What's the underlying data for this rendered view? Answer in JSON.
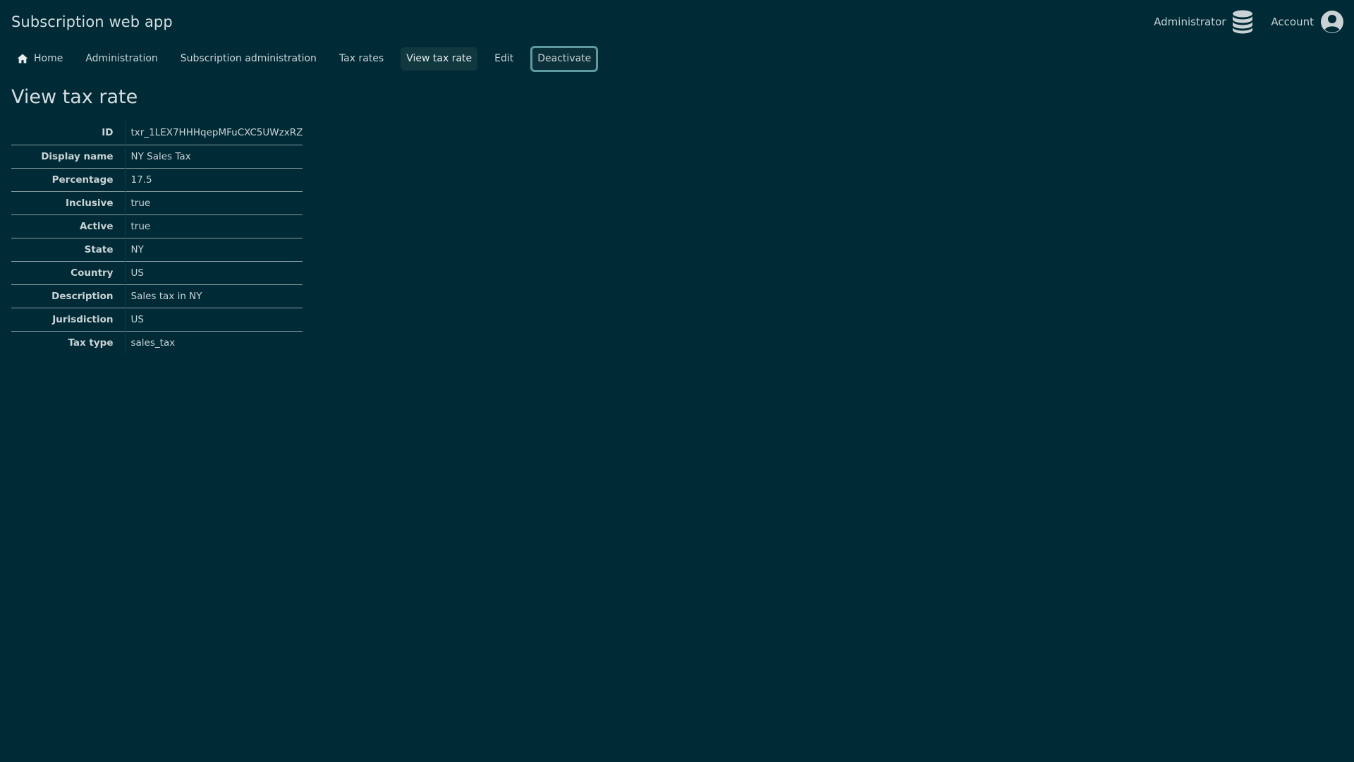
{
  "header": {
    "app_title": "Subscription web app",
    "administrator_label": "Administrator",
    "administrator_icon": "database-icon",
    "account_label": "Account",
    "account_icon": "user-circle-icon"
  },
  "nav": {
    "home_icon": "home-icon",
    "items": [
      {
        "label": "Home"
      },
      {
        "label": "Administration"
      },
      {
        "label": "Subscription administration"
      },
      {
        "label": "Tax rates"
      },
      {
        "label": "View tax rate"
      },
      {
        "label": "Edit"
      },
      {
        "label": "Deactivate"
      }
    ],
    "active_label": "View tax rate",
    "focused_label": "Deactivate"
  },
  "page": {
    "title": "View tax rate"
  },
  "details": [
    {
      "label": "ID",
      "value": "txr_1LEX7HHHqepMFuCXC5UWzxRZ"
    },
    {
      "label": "Display name",
      "value": "NY Sales Tax"
    },
    {
      "label": "Percentage",
      "value": "17.5"
    },
    {
      "label": "Inclusive",
      "value": "true"
    },
    {
      "label": "Active",
      "value": "true"
    },
    {
      "label": "State",
      "value": "NY"
    },
    {
      "label": "Country",
      "value": "US"
    },
    {
      "label": "Description",
      "value": "Sales tax in NY"
    },
    {
      "label": "Jurisdiction",
      "value": "US"
    },
    {
      "label": "Tax type",
      "value": "sales_tax"
    }
  ],
  "colors": {
    "background": "#002b36",
    "text": "#d6dde0",
    "active_nav_bg": "#12383f",
    "focus_ring": "#5f9aa0"
  }
}
